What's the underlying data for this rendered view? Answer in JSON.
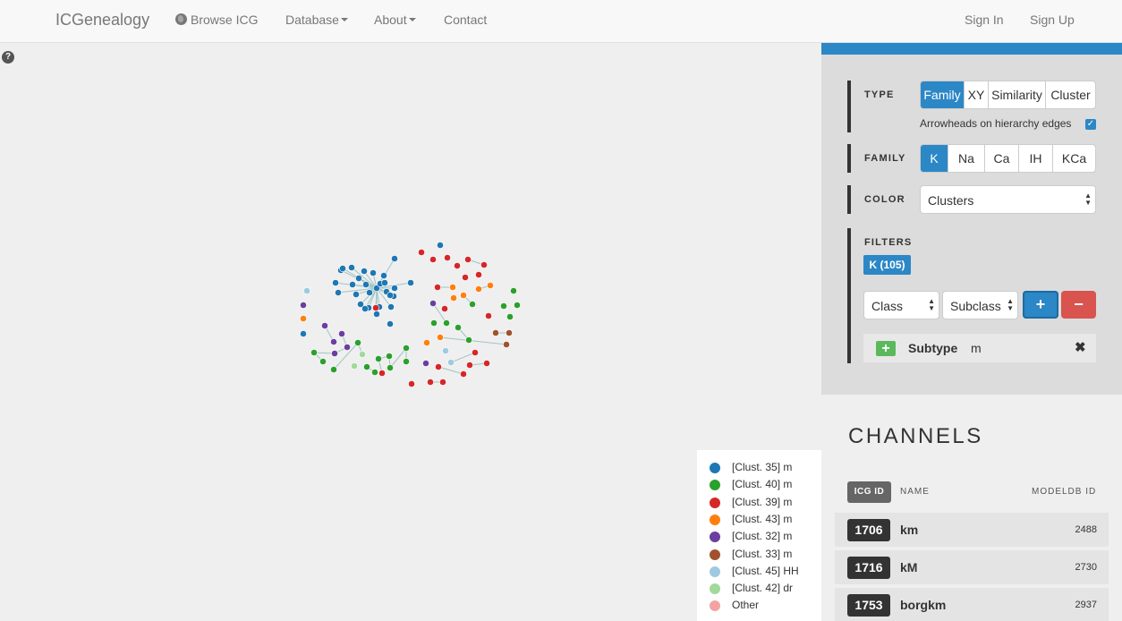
{
  "navbar": {
    "brand": "ICGenealogy",
    "browse": "Browse ICG",
    "database": "Database",
    "about": "About",
    "contact": "Contact",
    "signin": "Sign In",
    "signup": "Sign Up"
  },
  "help": "?",
  "controls": {
    "type": {
      "label": "TYPE",
      "options": [
        "Family",
        "XY",
        "Similarity",
        "Cluster"
      ],
      "selected": "Family",
      "arrowheads_label": "Arrowheads on hierarchy edges",
      "arrowheads_checked": true
    },
    "family": {
      "label": "FAMILY",
      "options": [
        "K",
        "Na",
        "Ca",
        "IH",
        "KCa"
      ],
      "selected": "K"
    },
    "color": {
      "label": "COLOR",
      "value": "Clusters"
    },
    "filters": {
      "label": "FILTERS",
      "badge": "K (105)",
      "class_select": "Class",
      "subclass_select": "Subclass",
      "plus": "+",
      "minus": "−",
      "subtype": {
        "add": "+",
        "label": "Subtype",
        "value": "m",
        "close": "✖"
      }
    }
  },
  "channels": {
    "title": "CHANNELS",
    "col_id": "ICG ID",
    "col_name": "NAME",
    "col_modeldb": "MODELDB ID",
    "rows": [
      {
        "id": "1706",
        "name": "km",
        "modeldb": "2488"
      },
      {
        "id": "1716",
        "name": "kM",
        "modeldb": "2730"
      },
      {
        "id": "1753",
        "name": "borgkm",
        "modeldb": "2937"
      }
    ]
  },
  "legend": [
    {
      "label": "[Clust. 35] m",
      "color": "#1f77b4"
    },
    {
      "label": "[Clust. 40] m",
      "color": "#2ca02c"
    },
    {
      "label": "[Clust. 39] m",
      "color": "#d62728"
    },
    {
      "label": "[Clust. 43] m",
      "color": "#ff7f0e"
    },
    {
      "label": "[Clust. 32] m",
      "color": "#6a3fa0"
    },
    {
      "label": "[Clust. 33] m",
      "color": "#a0522d"
    },
    {
      "label": "[Clust. 45] HH",
      "color": "#9ecae1"
    },
    {
      "label": "[Clust. 42] dr",
      "color": "#a1d99b"
    },
    {
      "label": "Other",
      "color": "#f4a3a3"
    }
  ],
  "colors": {
    "accent": "#2b87c6",
    "danger": "#d9534f",
    "success": "#5cb85c"
  }
}
